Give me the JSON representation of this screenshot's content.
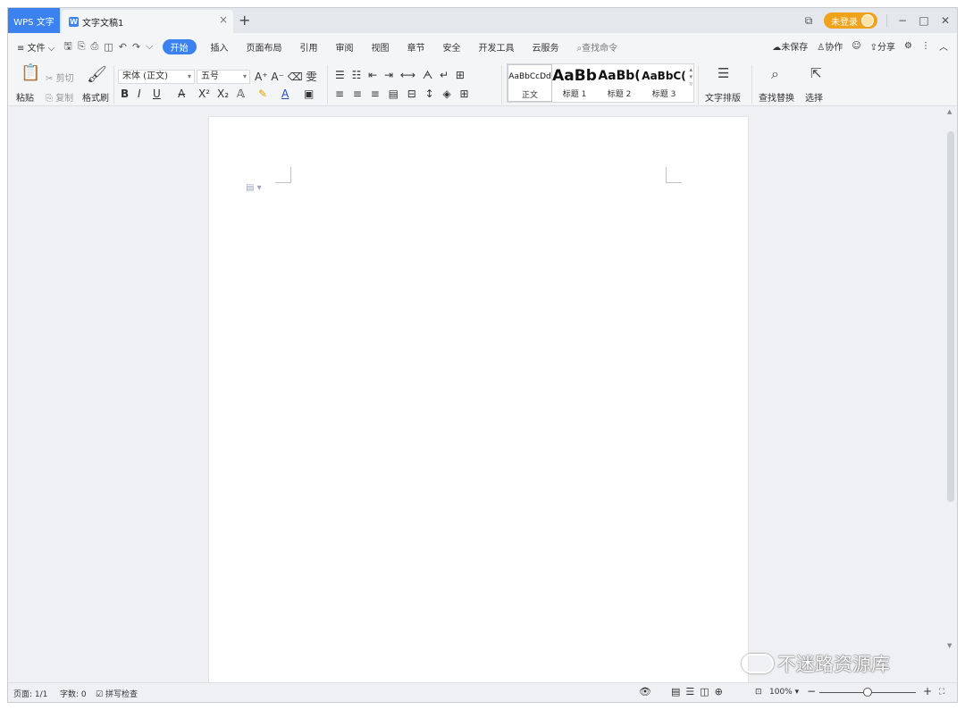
{
  "titlebar": {
    "home_tab": "WPS 文字",
    "doc_tab": "文字文稿1",
    "doc_icon_glyph": "W",
    "close_glyph": "×",
    "add_glyph": "+",
    "login": "未登录",
    "minimize": "−",
    "maximize": "□",
    "close": "✕"
  },
  "menu": {
    "file": "≡ 文件 ⌵",
    "items": [
      "开始",
      "插入",
      "页面布局",
      "引用",
      "审阅",
      "视图",
      "章节",
      "安全",
      "开发工具",
      "云服务"
    ],
    "search": "查找命令",
    "unsaved": "未保存",
    "collab": "协作",
    "share": "分享"
  },
  "ribbon": {
    "paste": "粘贴",
    "cut": "剪切",
    "copy": "复制",
    "format_painter": "格式刷",
    "font_name": "宋体 (正文)",
    "font_size": "五号",
    "styles": [
      {
        "preview": "AaBbCcDd",
        "label": "正文"
      },
      {
        "preview": "AaBb",
        "label": "标题 1"
      },
      {
        "preview": "AaBb(",
        "label": "标题 2"
      },
      {
        "preview": "AaBbC(",
        "label": "标题 3"
      }
    ],
    "text_layout": "文字排版",
    "find_replace": "查找替换",
    "select": "选择"
  },
  "status": {
    "page": "页面: 1/1",
    "words": "字数: 0",
    "spellcheck": "拼写检查",
    "zoom": "100%"
  },
  "watermark": "不迷路资源库",
  "colors": {
    "accent": "#3b82f0",
    "login": "#f0a21a"
  }
}
